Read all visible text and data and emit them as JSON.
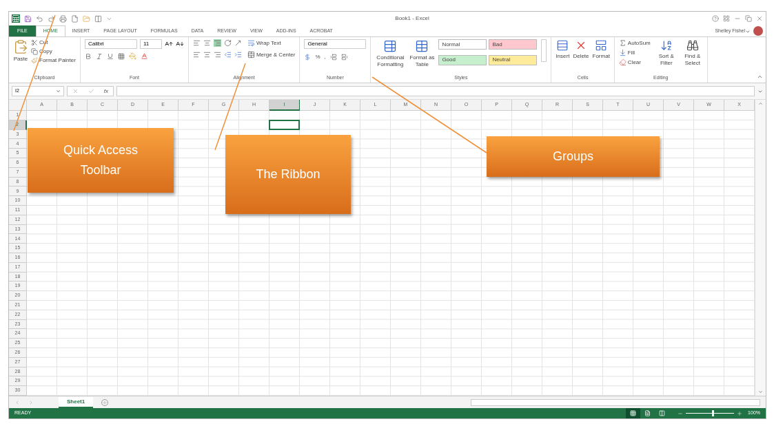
{
  "window": {
    "title": "Book1 - Excel",
    "user": "Shelley Fishel"
  },
  "ribbon_tabs": [
    {
      "label": "FILE",
      "kind": "file",
      "selected": false
    },
    {
      "label": "HOME",
      "kind": "tab",
      "selected": true
    },
    {
      "label": "INSERT",
      "kind": "tab",
      "selected": false
    },
    {
      "label": "PAGE LAYOUT",
      "kind": "tab",
      "selected": false
    },
    {
      "label": "FORMULAS",
      "kind": "tab",
      "selected": false
    },
    {
      "label": "DATA",
      "kind": "tab",
      "selected": false
    },
    {
      "label": "REVIEW",
      "kind": "tab",
      "selected": false
    },
    {
      "label": "VIEW",
      "kind": "tab",
      "selected": false
    },
    {
      "label": "ADD-INS",
      "kind": "tab",
      "selected": false
    },
    {
      "label": "ACROBAT",
      "kind": "tab",
      "selected": false
    }
  ],
  "groups": [
    {
      "kind": "clipboard",
      "label": "Clipboard",
      "items": [
        "Paste",
        "Cut",
        "Copy",
        "Format Painter"
      ]
    },
    {
      "kind": "font",
      "label": "Font",
      "font_name": "Calibri",
      "font_size": "11"
    },
    {
      "kind": "alignment",
      "label": "Alignment",
      "items": [
        "Wrap Text",
        "Merge & Center"
      ]
    },
    {
      "kind": "number",
      "label": "Number",
      "format": "General",
      "items": [
        "%",
        ","
      ]
    },
    {
      "kind": "styles",
      "label": "Styles",
      "items": [
        "Conditional Formatting",
        "Format as Table"
      ],
      "styles": [
        {
          "label": "Normal",
          "color": "#ffffff"
        },
        {
          "label": "Bad",
          "color": "#ffc7ce"
        },
        {
          "label": "Good",
          "color": "#c6efce"
        },
        {
          "label": "Neutral",
          "color": "#ffeb9c"
        }
      ]
    },
    {
      "kind": "cells",
      "label": "Cells",
      "items": [
        "Insert",
        "Delete",
        "Format"
      ]
    },
    {
      "kind": "editing",
      "label": "Editing",
      "items": [
        "AutoSum",
        "Fill",
        "Clear",
        "Sort & Filter",
        "Find & Select"
      ]
    }
  ],
  "formula_bar": {
    "name_box": "I2",
    "function_label": "fx"
  },
  "columns": [
    {
      "label": "A",
      "selected": false
    },
    {
      "label": "B",
      "selected": false
    },
    {
      "label": "C",
      "selected": false
    },
    {
      "label": "D",
      "selected": false
    },
    {
      "label": "E",
      "selected": false
    },
    {
      "label": "F",
      "selected": false
    },
    {
      "label": "G",
      "selected": false
    },
    {
      "label": "H",
      "selected": false
    },
    {
      "label": "I",
      "selected": true
    },
    {
      "label": "J",
      "selected": false
    },
    {
      "label": "K",
      "selected": false
    },
    {
      "label": "L",
      "selected": false
    },
    {
      "label": "M",
      "selected": false
    },
    {
      "label": "N",
      "selected": false
    },
    {
      "label": "O",
      "selected": false
    },
    {
      "label": "P",
      "selected": false
    },
    {
      "label": "Q",
      "selected": false
    },
    {
      "label": "R",
      "selected": false
    },
    {
      "label": "S",
      "selected": false
    },
    {
      "label": "T",
      "selected": false
    },
    {
      "label": "U",
      "selected": false
    },
    {
      "label": "V",
      "selected": false
    },
    {
      "label": "W",
      "selected": false
    },
    {
      "label": "X",
      "selected": false
    }
  ],
  "rows": [
    {
      "label": "1",
      "selected": false
    },
    {
      "label": "2",
      "selected": true
    },
    {
      "label": "3",
      "selected": false
    },
    {
      "label": "4",
      "selected": false
    },
    {
      "label": "5",
      "selected": false
    },
    {
      "label": "6",
      "selected": false
    },
    {
      "label": "7",
      "selected": false
    },
    {
      "label": "8",
      "selected": false
    },
    {
      "label": "9",
      "selected": false
    },
    {
      "label": "10",
      "selected": false
    },
    {
      "label": "11",
      "selected": false
    },
    {
      "label": "12",
      "selected": false
    },
    {
      "label": "13",
      "selected": false
    },
    {
      "label": "14",
      "selected": false
    },
    {
      "label": "15",
      "selected": false
    },
    {
      "label": "16",
      "selected": false
    },
    {
      "label": "17",
      "selected": false
    },
    {
      "label": "18",
      "selected": false
    },
    {
      "label": "19",
      "selected": false
    },
    {
      "label": "20",
      "selected": false
    },
    {
      "label": "21",
      "selected": false
    },
    {
      "label": "22",
      "selected": false
    },
    {
      "label": "23",
      "selected": false
    },
    {
      "label": "24",
      "selected": false
    },
    {
      "label": "25",
      "selected": false
    },
    {
      "label": "26",
      "selected": false
    },
    {
      "label": "27",
      "selected": false
    },
    {
      "label": "28",
      "selected": false
    },
    {
      "label": "29",
      "selected": false
    },
    {
      "label": "30",
      "selected": false
    }
  ],
  "sheet_tabs": [
    {
      "label": "Sheet1",
      "selected": true
    }
  ],
  "status_bar": {
    "text": "READY",
    "views": [
      {
        "kind": "normal",
        "selected": true
      },
      {
        "kind": "page_layout",
        "selected": false
      },
      {
        "kind": "page_break",
        "selected": false
      }
    ],
    "zoom": {
      "level": 0.55,
      "reading": "100%"
    }
  },
  "callouts": [
    {
      "label": "Quick Access Toolbar"
    },
    {
      "label": "The Ribbon"
    },
    {
      "label": "Groups"
    }
  ]
}
